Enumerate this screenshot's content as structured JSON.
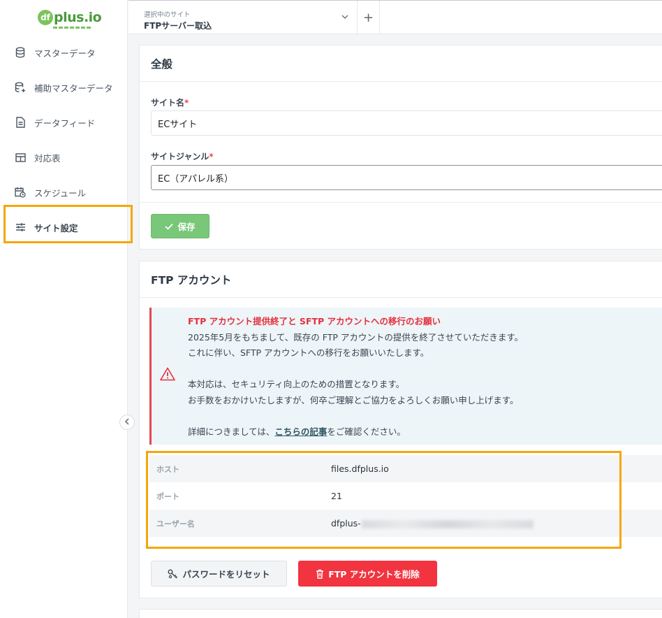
{
  "app": {
    "logo_text": "plus.io",
    "logo_mark": "df"
  },
  "sidebar": {
    "items": [
      {
        "label": "マスターデータ",
        "icon": "database-icon"
      },
      {
        "label": "補助マスターデータ",
        "icon": "database-plus-icon"
      },
      {
        "label": "データフィード",
        "icon": "document-icon"
      },
      {
        "label": "対応表",
        "icon": "table-icon"
      },
      {
        "label": "スケジュール",
        "icon": "calendar-clock-icon"
      },
      {
        "label": "サイト設定",
        "icon": "sliders-icon",
        "active": true
      }
    ]
  },
  "topbar": {
    "site_label": "選択中のサイト",
    "site_value": "FTPサーバー取込",
    "add_label": "+"
  },
  "general": {
    "title": "全般",
    "site_name_label": "サイト名",
    "site_name_value": "ECサイト",
    "site_genre_label": "サイトジャンル",
    "site_genre_value": "EC（アパレル系）",
    "required_mark": "*",
    "save_label": "保存"
  },
  "ftp": {
    "title": "FTP アカウント",
    "notice": {
      "title": "FTP アカウント提供終了と SFTP アカウントへの移行のお願い",
      "line1": "2025年5月をもちまして、既存の FTP アカウントの提供を終了させていただきます。",
      "line2": "これに伴い、SFTP アカウントへの移行をお願いいたします。",
      "line3": "本対応は、セキュリティ向上のための措置となります。",
      "line4": "お手数をおかけいたしますが、何卒ご理解とご協力をよろしくお願い申し上げます。",
      "line5_pre": "詳細につきましては、",
      "line5_link": "こちらの記事",
      "line5_post": "をご確認ください。"
    },
    "host_label": "ホスト",
    "host_value": "files.dfplus.io",
    "port_label": "ポート",
    "port_value": "21",
    "user_label": "ユーザー名",
    "user_value_prefix": "dfplus-",
    "reset_label": "パスワードをリセット",
    "delete_label": "FTP アカウントを削除"
  },
  "colors": {
    "accent_green": "#79c778",
    "danger": "#f1343f",
    "highlight": "#f6a609"
  }
}
